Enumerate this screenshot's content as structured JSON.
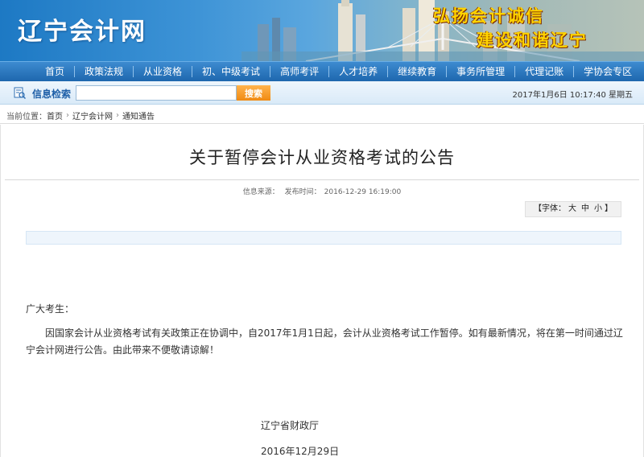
{
  "header": {
    "logo": "辽宁会计网",
    "slogan_line1": "弘扬会计诚信",
    "slogan_line2": "建设和谐辽宁"
  },
  "nav": {
    "items": [
      "首页",
      "政策法规",
      "从业资格",
      "初、中级考试",
      "高师考评",
      "人才培养",
      "继续教育",
      "事务所管理",
      "代理记账",
      "学协会专区"
    ]
  },
  "search": {
    "label": "信息检索",
    "value": "",
    "placeholder": "",
    "button": "搜索",
    "datetime": "2017年1月6日  10:17:40  星期五"
  },
  "breadcrumb": {
    "prefix": "当前位置：",
    "items": [
      "首页",
      "辽宁会计网",
      "通知通告"
    ]
  },
  "article": {
    "title": "关于暂停会计从业资格考试的公告",
    "source_label": "信息来源：",
    "publish_label": "发布时间：",
    "publish_time": "2016-12-29 16:19:00",
    "font_prefix": "【字体：",
    "font_large": "大",
    "font_medium": "中",
    "font_small": "小",
    "font_suffix": "】",
    "greeting": "广大考生：",
    "body": "因国家会计从业资格考试有关政策正在协调中，自2017年1月1日起，会计从业资格考试工作暂停。如有最新情况，将在第一时间通过辽宁会计网进行公告。由此带来不便敬请谅解！",
    "signature": "辽宁省财政厅",
    "date": "2016年12月29日"
  },
  "colors": {
    "nav_bg": "#2a78c0",
    "search_button": "#f5961f",
    "slogan": "#ffd400"
  }
}
